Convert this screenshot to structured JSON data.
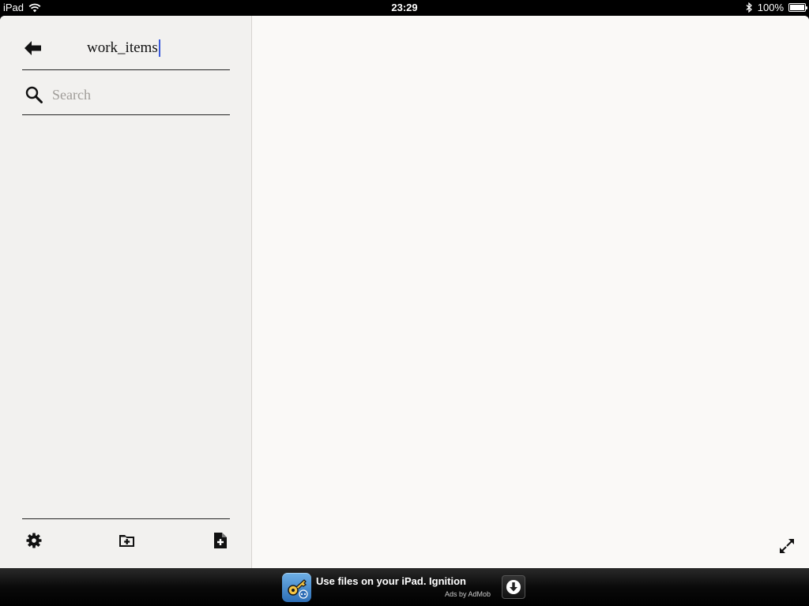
{
  "status_bar": {
    "device": "iPad",
    "time": "23:29",
    "battery": "100%",
    "battery_level": 1.0,
    "wifi_icon": "wifi-icon",
    "bluetooth_icon": "bluetooth-icon"
  },
  "sidebar": {
    "back_icon": "arrow-left-icon",
    "folder_name": "work_items",
    "search": {
      "placeholder": "Search",
      "value": ""
    },
    "files": [],
    "toolbar": {
      "settings_icon": "gear-icon",
      "new_folder_icon": "folder-plus-icon",
      "new_file_icon": "file-plus-icon"
    }
  },
  "main": {
    "fullscreen_icon": "expand-icon"
  },
  "ad": {
    "text": "Use files on your iPad. Ignition",
    "attribution": "Ads by AdMob",
    "download_icon": "download-icon"
  },
  "colors": {
    "sidebar_bg": "#f2f1ef",
    "main_bg": "#faf9f7",
    "caret": "#3b5bdb"
  }
}
